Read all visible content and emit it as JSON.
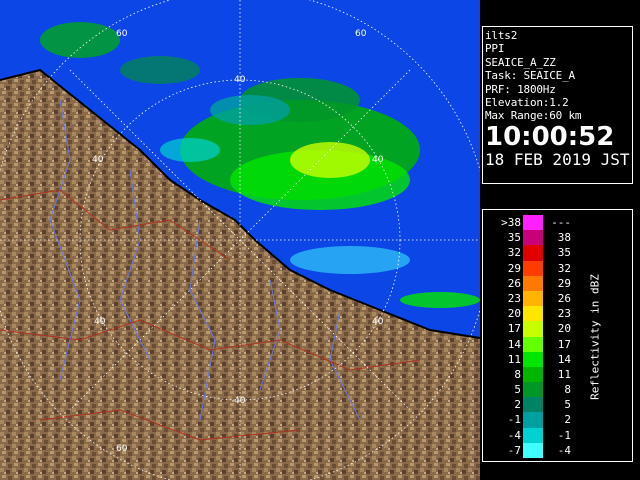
{
  "map": {
    "range_ring_labels": [
      "60",
      "40",
      "40",
      "40",
      "40",
      "40",
      "40",
      "60",
      "60"
    ],
    "colors": {
      "sea": "#0c46e6",
      "land_light": "#a88860",
      "land_dark": "#5a4030",
      "coast": "#000000",
      "river": "#6a7ad8",
      "boundary": "#b03020",
      "grid": "#ffffff"
    }
  },
  "info": {
    "lines": [
      "ilts2",
      "PPI",
      "SEAICE_A_ZZ",
      "Task: SEAICE_A",
      "PRF: 1800Hz",
      "Elevation:1.2",
      "Max Range:60 km"
    ],
    "time": "10:00:52",
    "date": "18 FEB 2019 JST"
  },
  "legend": {
    "unit": "Reflectivity in dBZ",
    "rows": [
      {
        "low": ">38",
        "high": "---",
        "color": "#ff20ff"
      },
      {
        "low": "35",
        "high": "38",
        "color": "#c8007a"
      },
      {
        "low": "32",
        "high": "35",
        "color": "#e00000"
      },
      {
        "low": "29",
        "high": "32",
        "color": "#ff3c00"
      },
      {
        "low": "26",
        "high": "29",
        "color": "#ff7800"
      },
      {
        "low": "23",
        "high": "26",
        "color": "#ffb400"
      },
      {
        "low": "20",
        "high": "23",
        "color": "#ffe600"
      },
      {
        "low": "17",
        "high": "20",
        "color": "#c8ff00"
      },
      {
        "low": "14",
        "high": "17",
        "color": "#64ff00"
      },
      {
        "low": "11",
        "high": "14",
        "color": "#00e600"
      },
      {
        "low": "8",
        "high": "11",
        "color": "#00b400"
      },
      {
        "low": "5",
        "high": "8",
        "color": "#009628"
      },
      {
        "low": "2",
        "high": "5",
        "color": "#008264"
      },
      {
        "low": "-1",
        "high": "2",
        "color": "#00a0a0"
      },
      {
        "low": "-4",
        "high": "-1",
        "color": "#00d2d2"
      },
      {
        "low": "-7",
        "high": "-4",
        "color": "#40ffff"
      }
    ]
  }
}
